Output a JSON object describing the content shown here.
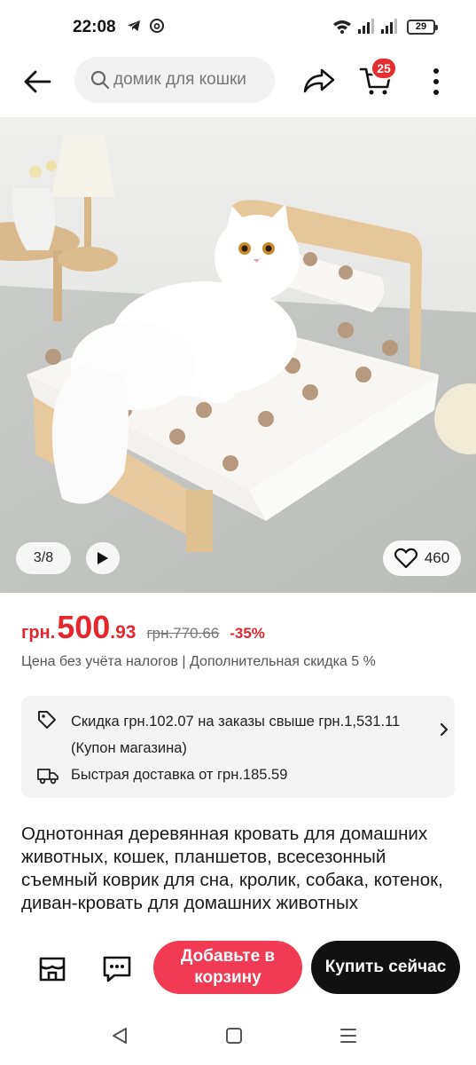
{
  "status_bar": {
    "time": "22:08",
    "battery": "29",
    "icons": [
      "telegram-icon",
      "threads-icon",
      "wifi-icon",
      "signal-icon",
      "signal-icon",
      "battery-icon"
    ]
  },
  "header": {
    "search_placeholder": "домик для кошки",
    "cart_count": "25",
    "icons": [
      "back-arrow-icon",
      "search-icon",
      "share-icon",
      "cart-icon",
      "more-vertical-icon"
    ]
  },
  "gallery": {
    "counter": "3/8",
    "likes": "460",
    "icons": [
      "play-icon",
      "heart-icon"
    ]
  },
  "price": {
    "currency": "грн.",
    "main": "500",
    "cents": ".93",
    "old_price": "грн.770.66",
    "discount": "-35%",
    "tax_note": "Цена без учёта налогов | Дополнительная скидка 5 %"
  },
  "coupon": {
    "text": "Скидка грн.102.07 на заказы свыше грн.1,531.11 (Купон магазина)",
    "delivery": "Быстрая доставка от грн.185.59",
    "icons": [
      "tag-icon",
      "truck-icon",
      "chevron-right-icon"
    ]
  },
  "product": {
    "title": "Однотонная деревянная кровать для домашних животных, кошек, планшетов, всесезонный съемный коврик для сна, кролик, собака, котенок, диван-кровать для домашних животных"
  },
  "actions": {
    "add_to_cart": "Добавьте в\nкорзину",
    "buy_now": "Купить сейчас",
    "icons": [
      "store-icon",
      "chat-icon"
    ]
  },
  "colors": {
    "accent_red": "#e4262d",
    "add_cart_button": "#f23a52",
    "buy_button": "#111111"
  }
}
